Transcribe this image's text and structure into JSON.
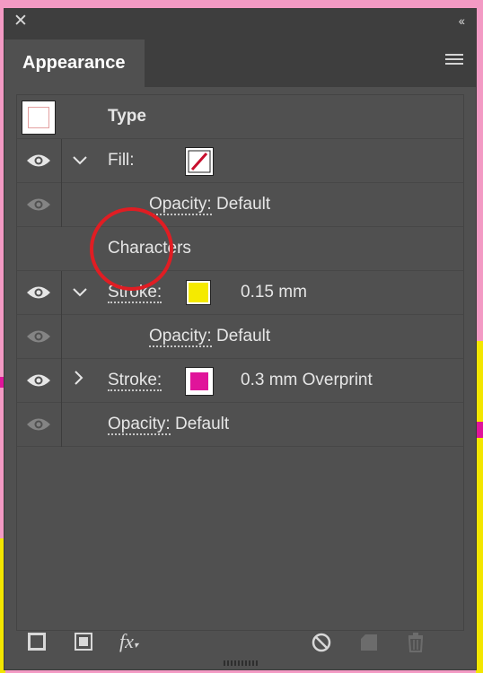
{
  "panel": {
    "close_label": "✕",
    "collapse_label": "‹‹",
    "tab_label": "Appearance"
  },
  "rows": {
    "type_label": "Type",
    "fill_label": "Fill:",
    "fill_opacity_label": "Opacity:",
    "fill_opacity_value": "Default",
    "characters_label": "Characters",
    "stroke1_label": "Stroke:",
    "stroke1_value": "0.15 mm",
    "stroke1_opacity_label": "Opacity:",
    "stroke1_opacity_value": "Default",
    "stroke2_label": "Stroke:",
    "stroke2_value": "0.3 mm Overprint",
    "opacity_label": "Opacity:",
    "opacity_value": "Default"
  },
  "colors": {
    "stroke1_swatch": "#f5ea00",
    "stroke2_swatch": "#e0149a",
    "fill_swatch_slash": "#c8102e",
    "highlight_circle": "#e01d23"
  },
  "icons": {
    "fx_label": "fx"
  }
}
